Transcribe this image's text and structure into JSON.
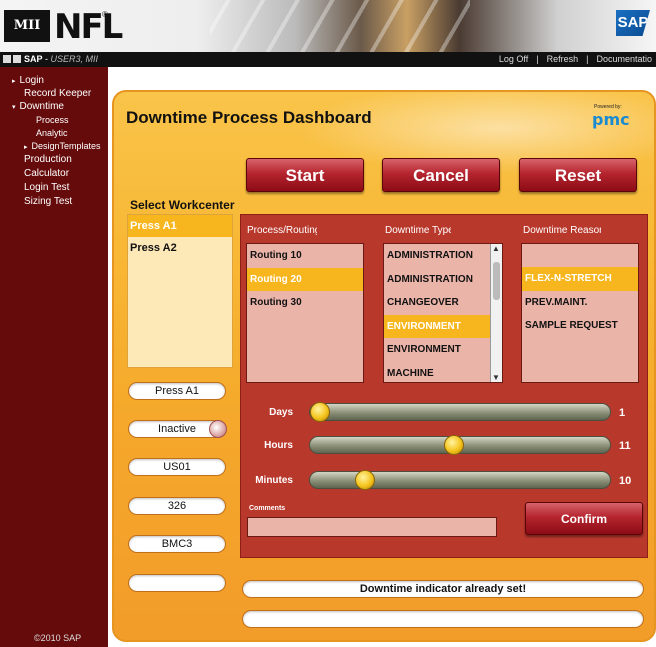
{
  "header": {
    "mii_label": "MII",
    "nfl_label": "NFL",
    "reg_mark": "®",
    "sap_label": "SAP"
  },
  "navbar": {
    "sap_text": "SAP",
    "user_text": "USER3, MII",
    "links": [
      "Log Off",
      "|",
      "Refresh",
      "|",
      "Documentatio"
    ]
  },
  "sidebar": {
    "items": [
      {
        "label": "Login",
        "arrow": "▸"
      },
      {
        "label": "Record Keeper",
        "arrow": ""
      },
      {
        "label": "Downtime",
        "arrow": "▾"
      },
      {
        "label": "Process",
        "arrow": ""
      },
      {
        "label": "Analytic",
        "arrow": ""
      },
      {
        "label": "DesignTemplates",
        "arrow": "▸"
      },
      {
        "label": "Production",
        "arrow": ""
      },
      {
        "label": "Calculator",
        "arrow": ""
      },
      {
        "label": "Login Test",
        "arrow": ""
      },
      {
        "label": "Sizing Test",
        "arrow": ""
      }
    ],
    "copyright": "©2010 SAP"
  },
  "dashboard": {
    "title": "Downtime Process Dashboard",
    "powered_by": "Powered by:",
    "pmc_logo": "pmc",
    "buttons": {
      "start": "Start",
      "cancel": "Cancel",
      "reset": "Reset",
      "confirm": "Confirm"
    },
    "workcenter": {
      "label": "Select Workcenter",
      "items": [
        "Press A1",
        "Press A2"
      ],
      "selected_index": 0
    },
    "fields": {
      "workcenter": "Press A1",
      "status": "Inactive",
      "code1": "US01",
      "code2": "326",
      "code3": "BMC3",
      "empty": ""
    },
    "routing": {
      "header": "Process/Routing",
      "items": [
        "Routing 10",
        "Routing 20",
        "Routing 30"
      ],
      "selected_index": 1
    },
    "downtime_type": {
      "header": "Downtime Type",
      "items": [
        "ADMINISTRATION",
        "ADMINISTRATION",
        "CHANGEOVER",
        "ENVIRONMENT",
        "ENVIRONMENT",
        "MACHINE"
      ],
      "selected_index": 3
    },
    "downtime_reason": {
      "header": "Downtime Reason",
      "items": [
        "FLEX-N-STRETCH",
        "PREV.MAINT.",
        "SAMPLE REQUEST"
      ],
      "selected_index": 0
    },
    "sliders": {
      "days": {
        "label": "Days",
        "value": "1",
        "fraction": 0.0
      },
      "hours": {
        "label": "Hours",
        "value": "11",
        "fraction": 0.48
      },
      "minutes": {
        "label": "Minutes",
        "value": "10",
        "fraction": 0.16
      }
    },
    "comments_label": "Comments",
    "status_message": "Downtime indicator already set!",
    "status_message_2": ""
  },
  "colors": {
    "sidebar_bg": "#650b0b",
    "panel_orange": "#f8b734",
    "selection": "#f8b61e",
    "button_red": "#b5252f",
    "inner_panel": "#b9382c"
  }
}
